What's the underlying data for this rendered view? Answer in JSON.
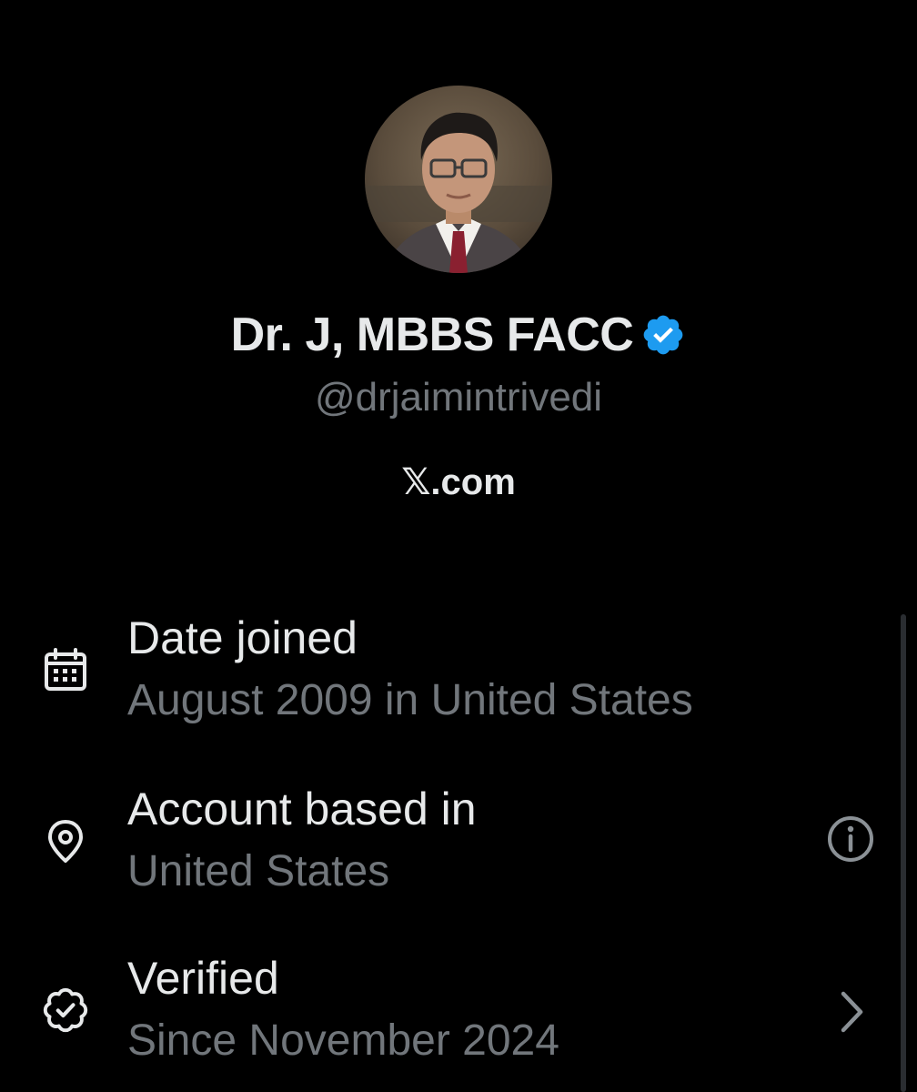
{
  "profile": {
    "display_name": "Dr. J, MBBS FACC",
    "handle": "@drjaimintrivedi",
    "verified_badge_color": "#1d9bf0",
    "site_label": "𝕏.com",
    "avatar_icon": "profile-photo"
  },
  "about": {
    "rows": [
      {
        "icon": "calendar-icon",
        "label": "Date joined",
        "value": "August 2009 in United States"
      },
      {
        "icon": "location-pin-icon",
        "label": "Account based in",
        "value": "United States",
        "action_icon": "info-icon"
      },
      {
        "icon": "verified-badge-outline-icon",
        "label": "Verified",
        "value": "Since November 2024",
        "action_icon": "chevron-right-icon"
      }
    ]
  },
  "colors": {
    "background": "#000000",
    "primary_text": "#e7e9ea",
    "secondary_text": "#71767b",
    "accent": "#1d9bf0"
  }
}
